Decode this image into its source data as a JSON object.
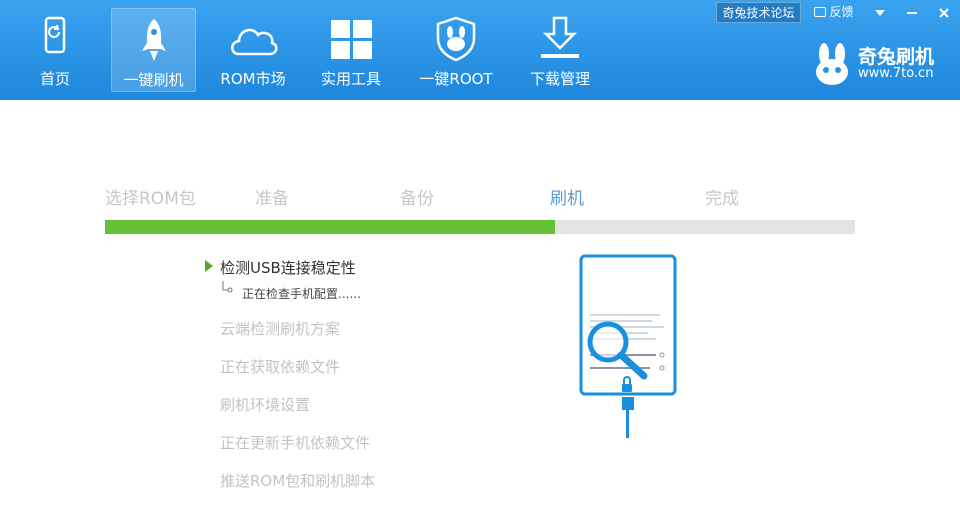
{
  "window": {
    "forum_label": "奇兔技术论坛",
    "feedback_label": "反馈"
  },
  "nav": {
    "items": [
      {
        "label": "首页",
        "icon": "phone-refresh-icon"
      },
      {
        "label": "一键刷机",
        "icon": "rocket-icon",
        "active": true
      },
      {
        "label": "ROM市场",
        "icon": "cloud-icon"
      },
      {
        "label": "实用工具",
        "icon": "windows-grid-icon"
      },
      {
        "label": "一键ROOT",
        "icon": "rabbit-shield-icon"
      },
      {
        "label": "下载管理",
        "icon": "download-icon"
      }
    ]
  },
  "brand": {
    "name": "奇兔刷机",
    "url": "www.7to.cn"
  },
  "steps": {
    "items": [
      {
        "label": "选择ROM包",
        "state": "done"
      },
      {
        "label": "准备",
        "state": "done"
      },
      {
        "label": "备份",
        "state": "done"
      },
      {
        "label": "刷机",
        "state": "current"
      },
      {
        "label": "完成",
        "state": "pending"
      }
    ],
    "progress_fraction": 0.6
  },
  "tasks": {
    "active": "检测USB连接稳定性",
    "active_status": "正在检查手机配置......",
    "pending": [
      "云端检测刷机方案",
      "正在获取依赖文件",
      "刷机环境设置",
      "正在更新手机依赖文件",
      "推送ROM包和刷机脚本"
    ]
  },
  "colors": {
    "header": "#2a93e6",
    "progress": "#66c235",
    "current_step": "#5a9bd5",
    "illustration": "#1a8fe0"
  }
}
